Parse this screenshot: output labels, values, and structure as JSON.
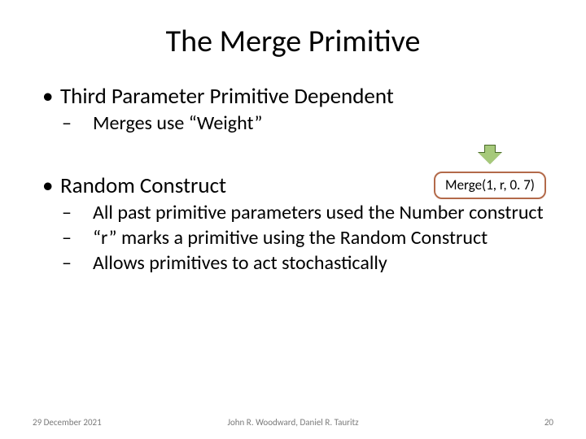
{
  "title": "The Merge Primitive",
  "bullets": {
    "b1": "Third Parameter Primitive Dependent",
    "b1a": "Merges use “Weight”",
    "b2": "Random Construct",
    "b2a": "All past primitive parameters used the Number construct",
    "b2b": "“r” marks a primitive using the Random Construct",
    "b2c": "Allows primitives to act stochastically"
  },
  "callout": "Merge(1, r, 0. 7)",
  "footer": {
    "date": "29 December 2021",
    "authors": "John R. Woodward, Daniel R. Tauritz",
    "page": "20"
  }
}
